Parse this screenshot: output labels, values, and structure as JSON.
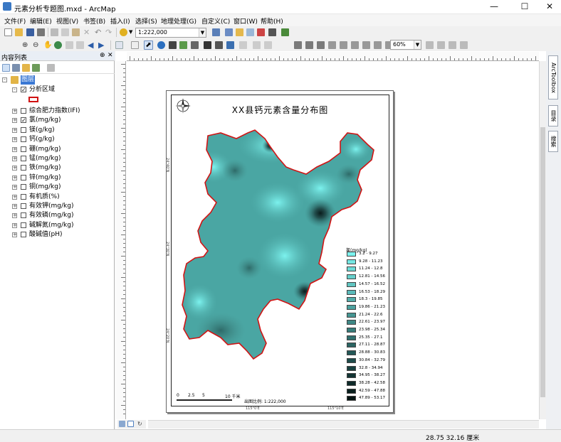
{
  "window": {
    "title": "元素分析专题图.mxd - ArcMap"
  },
  "menu": [
    "文件(F)",
    "编辑(E)",
    "视图(V)",
    "书签(B)",
    "插入(I)",
    "选择(S)",
    "地理处理(G)",
    "自定义(C)",
    "窗口(W)",
    "帮助(H)"
  ],
  "toolbar": {
    "scale": "1:222,000",
    "zoom": "60%"
  },
  "toc": {
    "title": "内容列表",
    "root": "图层",
    "group": "分析区域",
    "layers": [
      {
        "label": "综合肥力指数(IFI)",
        "checked": false
      },
      {
        "label": "氯(mg/kg)",
        "checked": true
      },
      {
        "label": "镁(g/kg)",
        "checked": false
      },
      {
        "label": "钙(g/kg)",
        "checked": false
      },
      {
        "label": "硼(mg/kg)",
        "checked": false
      },
      {
        "label": "锰(mg/kg)",
        "checked": false
      },
      {
        "label": "铁(mg/kg)",
        "checked": false
      },
      {
        "label": "锌(mg/kg)",
        "checked": false
      },
      {
        "label": "铜(mg/kg)",
        "checked": false
      },
      {
        "label": "有机质(%)",
        "checked": false
      },
      {
        "label": "有效钾(mg/kg)",
        "checked": false
      },
      {
        "label": "有效磷(mg/kg)",
        "checked": false
      },
      {
        "label": "碱解氮(mg/kg)",
        "checked": false
      },
      {
        "label": "酸碱值(pH)",
        "checked": false
      }
    ]
  },
  "side_tabs": [
    "ArcToolbox",
    "目录",
    "搜索"
  ],
  "map": {
    "title": "XX县钙元素含量分布图",
    "legend_title": "氯(mg/kg)",
    "scale_text": "出图比例: 1:222,000",
    "scalebar_labels": [
      "0",
      "2.5",
      "5",
      "10 千米"
    ],
    "legend": [
      {
        "label": "3.2 - 9.27",
        "color": "#7cf2ee"
      },
      {
        "label": "9.28 - 11.23",
        "color": "#74e6e2"
      },
      {
        "label": "11.24 - 12.8",
        "color": "#6cdad6"
      },
      {
        "label": "12.81 - 14.56",
        "color": "#66cfcb"
      },
      {
        "label": "14.57 - 16.52",
        "color": "#60c5c1"
      },
      {
        "label": "16.53 - 18.29",
        "color": "#5ababa"
      },
      {
        "label": "18.3 - 19.85",
        "color": "#53adaa"
      },
      {
        "label": "19.86 - 21.23",
        "color": "#4ca19e"
      },
      {
        "label": "21.24 - 22.6",
        "color": "#459592"
      },
      {
        "label": "22.61 - 23.97",
        "color": "#3e8886"
      },
      {
        "label": "23.98 - 25.34",
        "color": "#377c7a"
      },
      {
        "label": "25.35 - 27.1",
        "color": "#30706e"
      },
      {
        "label": "27.11 - 28.87",
        "color": "#2a6462"
      },
      {
        "label": "28.88 - 30.83",
        "color": "#245857"
      },
      {
        "label": "30.84 - 32.79",
        "color": "#1e4c4b"
      },
      {
        "label": "32.8 - 34.94",
        "color": "#18403f"
      },
      {
        "label": "34.95 - 38.27",
        "color": "#133534"
      },
      {
        "label": "38.28 - 42.58",
        "color": "#0e2a29"
      },
      {
        "label": "42.59 - 47.88",
        "color": "#091f1e"
      },
      {
        "label": "47.89 - 53.17",
        "color": "#041413"
      }
    ]
  },
  "status": {
    "coords": "28.75  32.16 厘米"
  }
}
